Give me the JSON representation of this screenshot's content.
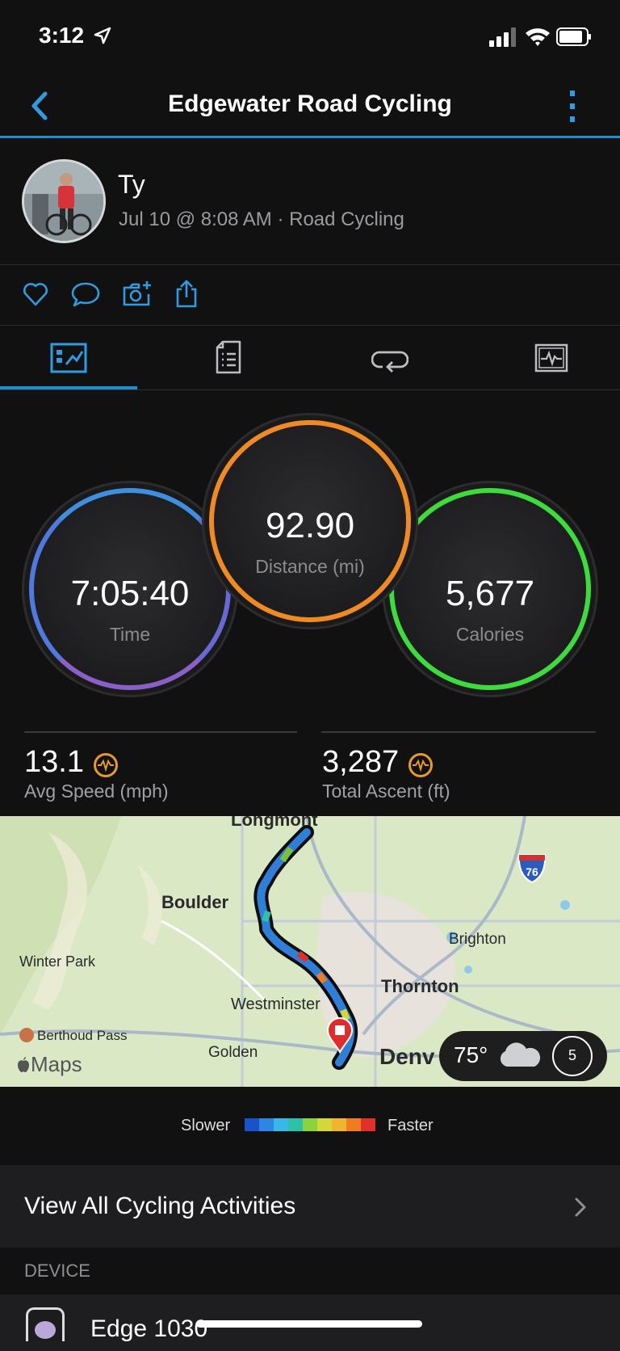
{
  "status": {
    "time": "3:12"
  },
  "nav": {
    "title": "Edgewater Road Cycling",
    "back_icon": "chevron-left-icon",
    "more_icon": "vertical-dots-icon"
  },
  "profile": {
    "name": "Ty",
    "meta": "Jul 10 @ 8:08 AM · Road Cycling"
  },
  "actions": [
    "heart-icon",
    "comment-icon",
    "camera-add-icon",
    "share-icon"
  ],
  "tabs": [
    {
      "icon": "overview-icon",
      "active": true
    },
    {
      "icon": "details-icon",
      "active": false
    },
    {
      "icon": "laps-icon",
      "active": false
    },
    {
      "icon": "charts-icon",
      "active": false
    }
  ],
  "summary": {
    "time": {
      "value": "7:05:40",
      "label": "Time"
    },
    "distance": {
      "value": "92.90",
      "label": "Distance (mi)"
    },
    "calories": {
      "value": "5,677",
      "label": "Calories"
    }
  },
  "stats": [
    {
      "value": "13.1",
      "label": "Avg Speed (mph)"
    },
    {
      "value": "3,287",
      "label": "Total Ascent (ft)"
    }
  ],
  "map": {
    "places": {
      "longmont": "Longmont",
      "boulder": "Boulder",
      "winter_park": "Winter Park",
      "brighton": "Brighton",
      "thornton": "Thornton",
      "westminster": "Westminster",
      "berthoud": "Berthoud Pass",
      "golden": "Golden",
      "denver": "Denv"
    },
    "interstate": "76",
    "attribution": "Maps",
    "weather": {
      "temp": "75°",
      "wind": "5"
    }
  },
  "legend": {
    "slower": "Slower",
    "faster": "Faster",
    "colors": [
      "#1a52c9",
      "#2d86e0",
      "#39b7e6",
      "#2fc0a8",
      "#8bd23c",
      "#d2d83a",
      "#f0b52e",
      "#f07c22",
      "#e0302a"
    ]
  },
  "view_all": {
    "label": "View All Cycling Activities"
  },
  "device": {
    "header": "DEVICE",
    "name": "Edge 1030"
  }
}
